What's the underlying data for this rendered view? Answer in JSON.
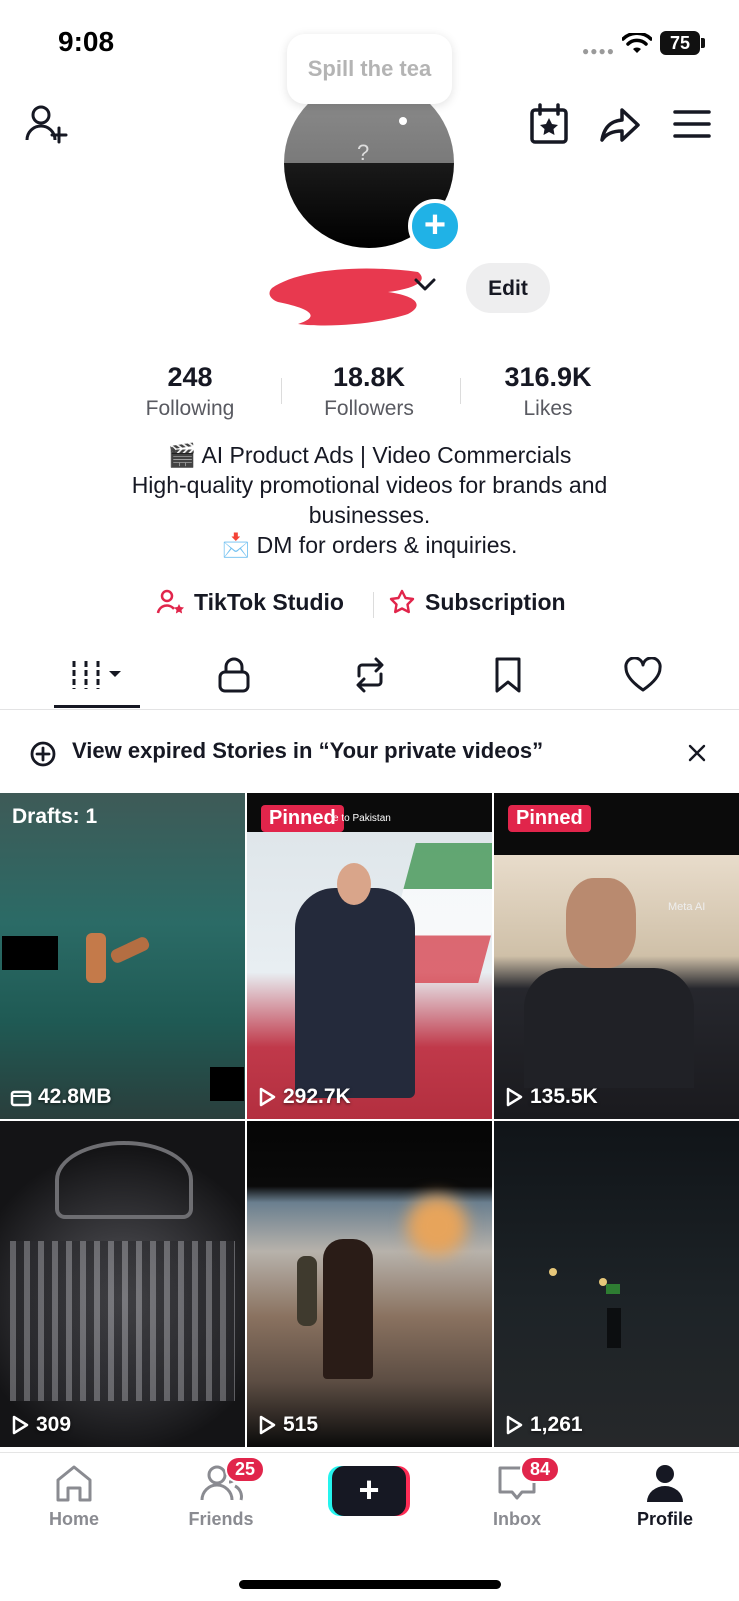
{
  "status_bar": {
    "time": "9:08",
    "battery": "75"
  },
  "tooltip": "Spill the tea",
  "profile": {
    "avatar_placeholder": "?",
    "edit_label": "Edit",
    "stats": [
      {
        "value": "248",
        "label": "Following"
      },
      {
        "value": "18.8K",
        "label": "Followers"
      },
      {
        "value": "316.9K",
        "label": "Likes"
      }
    ],
    "bio": {
      "line1": "AI Product Ads | Video Commercials",
      "line2": "High-quality promotional videos for brands and",
      "line3": "businesses.",
      "line4": "DM for orders & inquiries."
    },
    "links": {
      "studio": "TikTok Studio",
      "subscription": "Subscription"
    }
  },
  "banner": {
    "text": "View expired Stories in “Your private videos”"
  },
  "grid": [
    {
      "badge": "Drafts: 1",
      "stat": "42.8MB",
      "stat_icon": "storage-icon"
    },
    {
      "badge": "Pinned",
      "stat": "292.7K",
      "stat_icon": "play-icon",
      "overlay_caption": "e to Pakistan"
    },
    {
      "badge": "Pinned",
      "stat": "135.5K",
      "stat_icon": "play-icon",
      "overlay_caption": "Meta AI"
    },
    {
      "badge": "",
      "stat": "309",
      "stat_icon": "play-icon"
    },
    {
      "badge": "",
      "stat": "515",
      "stat_icon": "play-icon"
    },
    {
      "badge": "",
      "stat": "1,261",
      "stat_icon": "play-icon"
    }
  ],
  "bottom_nav": {
    "home": "Home",
    "friends": "Friends",
    "friends_badge": "25",
    "create": "+",
    "inbox": "Inbox",
    "inbox_badge": "84",
    "profile": "Profile"
  },
  "colors": {
    "accent": "#e1254b",
    "avatar_plus": "#20b2e6",
    "text": "#161823",
    "muted": "#595a61"
  }
}
